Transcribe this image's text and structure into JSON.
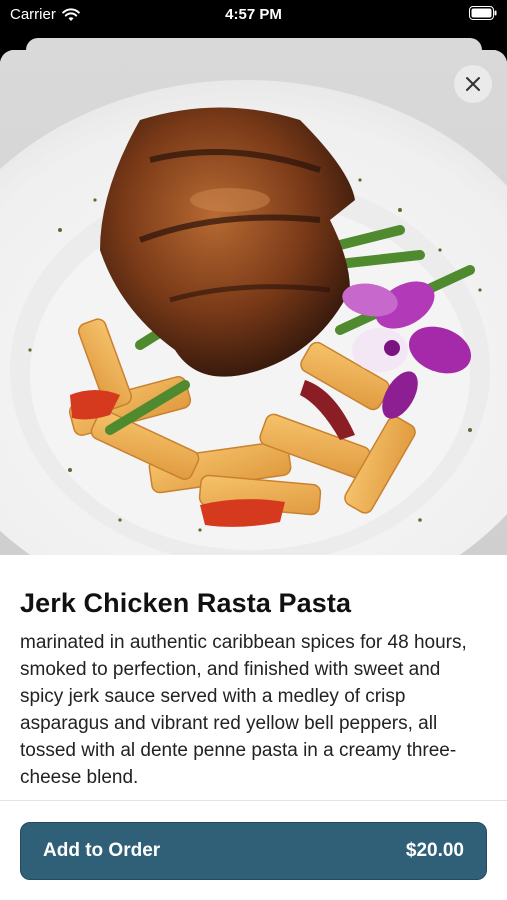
{
  "status_bar": {
    "carrier": "Carrier",
    "time": "4:57 PM"
  },
  "item": {
    "title": "Jerk Chicken Rasta Pasta",
    "description": "marinated in authentic caribbean spices for 48 hours, smoked to perfection, and finished with sweet and spicy jerk sauce served with a medley of crisp asparagus and vibrant red yellow bell peppers, all tossed with al dente penne pasta in a creamy three-cheese blend."
  },
  "order_button": {
    "label": "Add to Order",
    "price": "$20.00"
  },
  "colors": {
    "accent": "#2f6078"
  },
  "icons": {
    "close": "close-icon",
    "wifi": "wifi-icon",
    "battery": "battery-icon"
  }
}
